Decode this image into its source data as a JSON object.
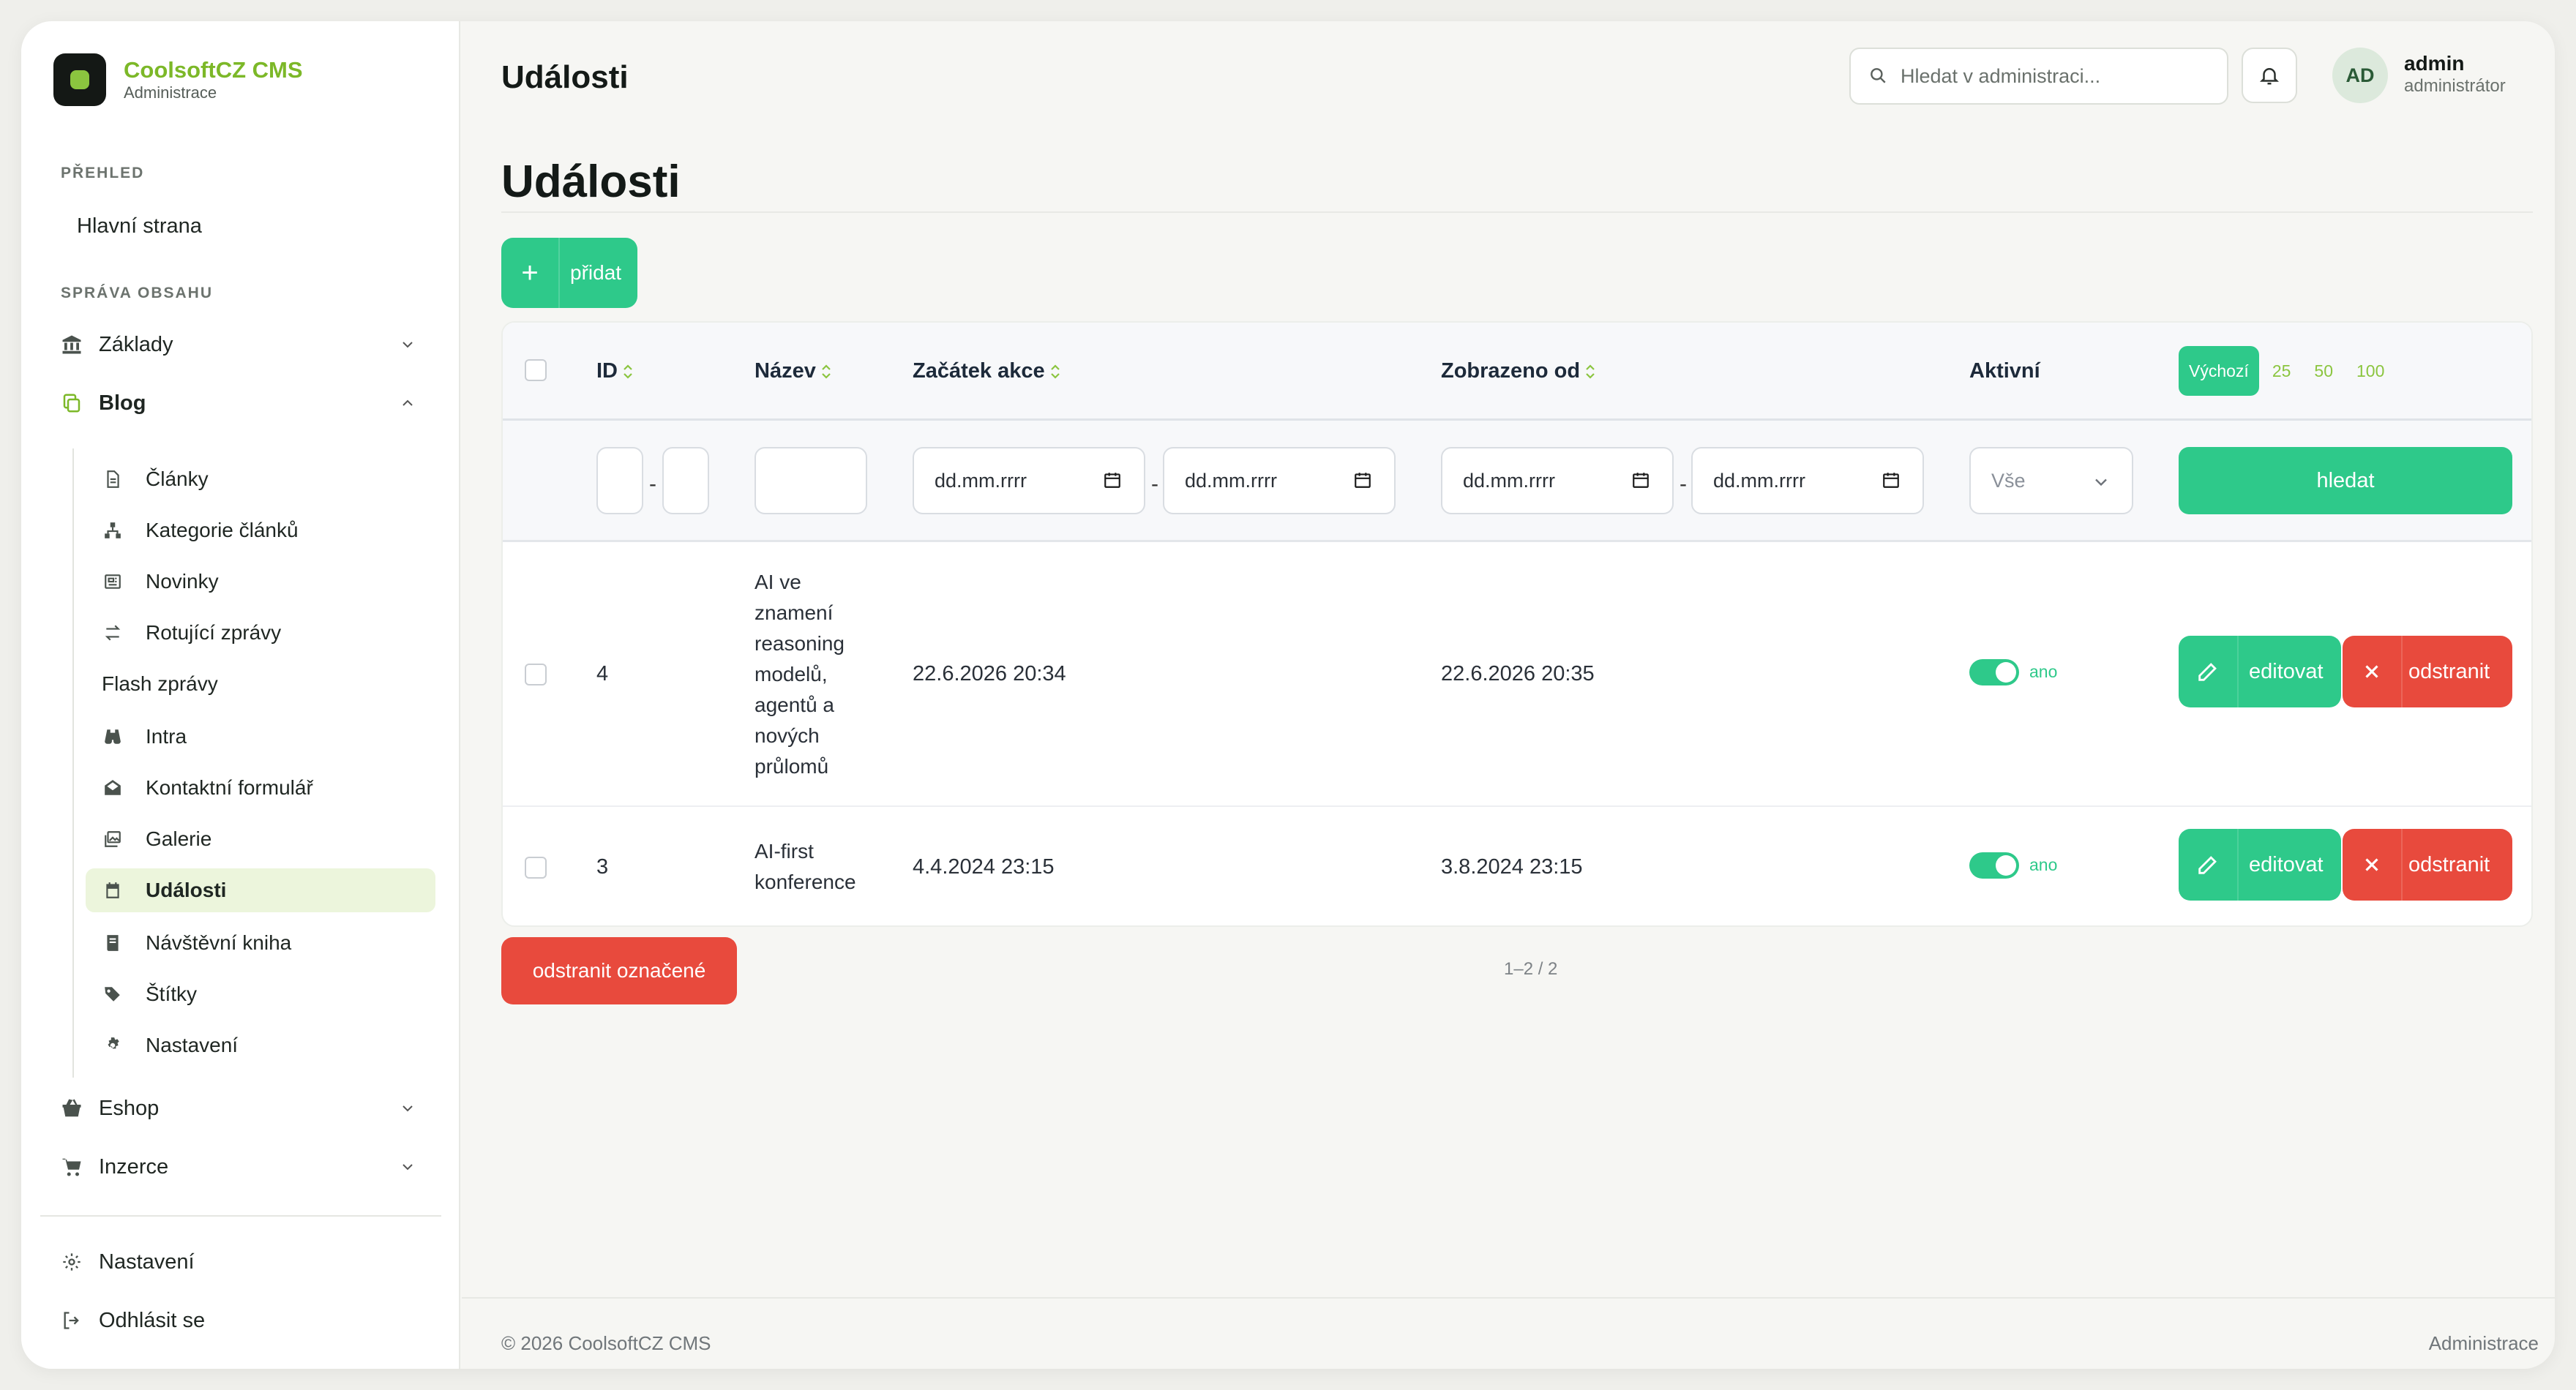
{
  "brand": {
    "name": "CoolsoftCZ CMS",
    "subtitle": "Administrace",
    "accent": "#8bc53f"
  },
  "sidebar": {
    "section_overview": "PŘEHLED",
    "home": "Hlavní strana",
    "section_content": "SPRÁVA OBSAHU",
    "zaklady": "Základy",
    "blog": "Blog",
    "blog_items": [
      {
        "label": "Články",
        "icon": "document-icon"
      },
      {
        "label": "Kategorie článků",
        "icon": "hierarchy-icon"
      },
      {
        "label": "Novinky",
        "icon": "newspaper-icon"
      },
      {
        "label": "Rotující zprávy",
        "icon": "arrows-swap-icon"
      },
      {
        "label": "Flash zprávy",
        "icon": ""
      },
      {
        "label": "Intra",
        "icon": "binoculars-icon"
      },
      {
        "label": "Kontaktní formulář",
        "icon": "envelope-open-icon"
      },
      {
        "label": "Galerie",
        "icon": "images-icon"
      },
      {
        "label": "Události",
        "icon": "calendar-icon",
        "active": true
      },
      {
        "label": "Návštěvní kniha",
        "icon": "book-icon"
      },
      {
        "label": "Štítky",
        "icon": "tags-icon"
      },
      {
        "label": "Nastavení",
        "icon": "gear-icon"
      }
    ],
    "eshop": "Eshop",
    "inzerce": "Inzerce",
    "settings": "Nastavení",
    "logout": "Odhlásit se"
  },
  "topbar": {
    "title": "Události",
    "search_placeholder": "Hledat v administraci...",
    "avatar_initials": "AD",
    "user_name": "admin",
    "user_role": "administrátor"
  },
  "page": {
    "title": "Události",
    "add_label": "přidat"
  },
  "table": {
    "columns": {
      "id": "ID",
      "name": "Název",
      "start": "Začátek akce",
      "shown_from": "Zobrazeno od",
      "active": "Aktivní"
    },
    "per_page": [
      "Výchozí",
      "25",
      "50",
      "100"
    ],
    "per_page_selected": "Výchozí",
    "filters": {
      "date_placeholder": "dd.mm.rrrr",
      "active_select": "Vše",
      "search_label": "hledat"
    },
    "rows": [
      {
        "id": "4",
        "name": "AI ve znamení reasoning modelů, agentů a nových průlomů",
        "start": "22.6.2026 20:34",
        "shown_from": "22.6.2026 20:35",
        "active": "ano"
      },
      {
        "id": "3",
        "name": "AI-first konference",
        "start": "4.4.2024 23:15",
        "shown_from": "3.8.2024 23:15",
        "active": "ano"
      }
    ],
    "edit_label": "editovat",
    "delete_label": "odstranit"
  },
  "bulk": {
    "delete_selected": "odstranit označené",
    "paging": "1–2 / 2"
  },
  "footer": {
    "copyright": "© 2026 CoolsoftCZ CMS",
    "right": "Administrace"
  },
  "colors": {
    "green": "#2ec98a",
    "red": "#e84a3d",
    "active_bg": "#ecf5dc"
  }
}
